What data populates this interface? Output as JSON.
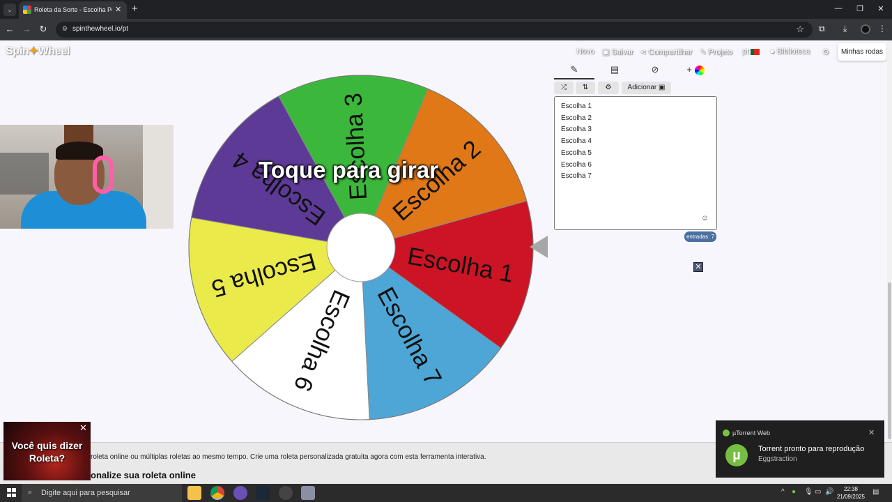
{
  "browser": {
    "tab_title": "Roleta da Sorte - Escolha Personalizada",
    "url": "spinthewheel.io/pt",
    "new_tab": "+",
    "close": "✕"
  },
  "site": {
    "logo_prefix": "Spin",
    "logo_mark": "✦",
    "logo_suffix": "Wheel",
    "menu": {
      "novo": "Novo",
      "salvar": "Salvar",
      "compartilhar": "Compartilhar",
      "projeto": "Projeto",
      "lang": "pt",
      "biblioteca": "Biblioteca"
    },
    "minhas_rodas": "Minhas rodas"
  },
  "wheel": {
    "cta": "Toque para girar",
    "segments": [
      {
        "label": "Escolha 1",
        "color": "#cc1424"
      },
      {
        "label": "Escolha 2",
        "color": "#e07818"
      },
      {
        "label": "Escolha 3",
        "color": "#3bb83b"
      },
      {
        "label": "Escolha 4",
        "color": "#5d3a96"
      },
      {
        "label": "Escolha 5",
        "color": "#eaea4a"
      },
      {
        "label": "Escolha 6",
        "color": "#ffffff"
      },
      {
        "label": "Escolha 7",
        "color": "#4ea6d6"
      }
    ]
  },
  "editor": {
    "add_label": "Adicionar",
    "entries": [
      "Escolha 1",
      "Escolha 2",
      "Escolha 3",
      "Escolha 4",
      "Escolha 5",
      "Escolha 6",
      "Escolha 7"
    ],
    "count_badge": "entradas: 7"
  },
  "footer": {
    "description": "roleta online ou múltiplas roletas ao mesmo tempo. Crie uma roleta personalizada gratuita agora com esta ferramenta interativa.",
    "heading": "onalize sua roleta online"
  },
  "ad": {
    "text": "Você quis dizer Roleta?"
  },
  "toast": {
    "app": "µTorrent Web",
    "title": "Torrent pronto para reprodução",
    "subtitle": "Eggstraction"
  },
  "taskbar": {
    "search_placeholder": "Digite aqui para pesquisar",
    "time": "22:38",
    "date": "21/09/2025"
  }
}
